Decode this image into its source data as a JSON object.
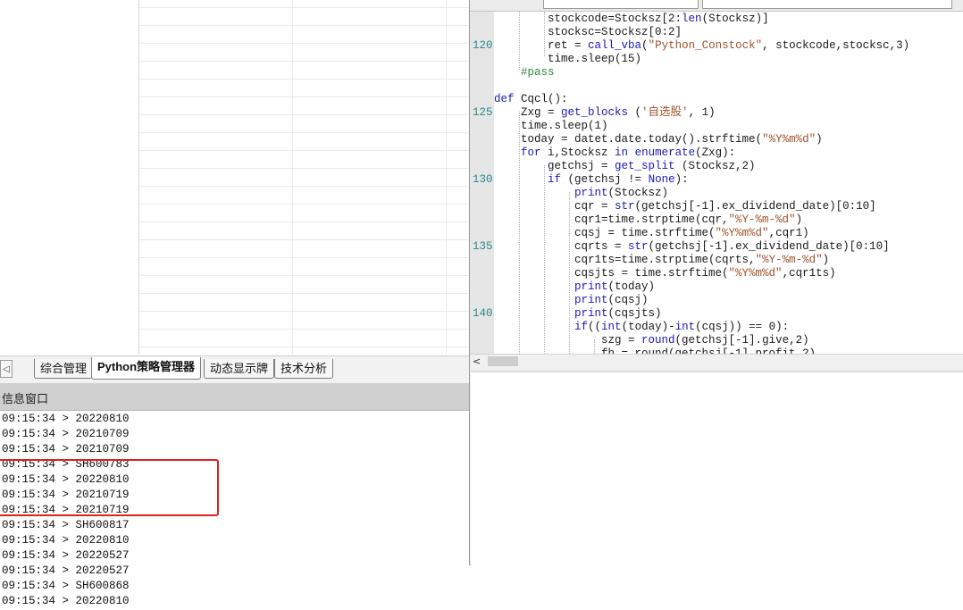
{
  "tabs": {
    "scroll_left": "◁",
    "items": [
      {
        "label": "综合管理"
      },
      {
        "label": "Python策略管理器"
      },
      {
        "label": "动态显示牌"
      },
      {
        "label": "技术分析"
      }
    ]
  },
  "info_window": {
    "title": "信息窗口",
    "lines": [
      "09:15:34 > 20220810",
      "09:15:34 > 20210709",
      "09:15:34 > 20210709",
      "09:15:34 > SH600783",
      "09:15:34 > 20220810",
      "09:15:34 > 20210719",
      "09:15:34 > 20210719",
      "09:15:34 > SH600817",
      "09:15:34 > 20220810",
      "09:15:34 > 20220527",
      "09:15:34 > 20220527",
      "09:15:34 > SH600868",
      "09:15:34 > 20220810"
    ]
  },
  "editor": {
    "line_numbers": [
      {
        "n": "120",
        "row": 2
      },
      {
        "n": "125",
        "row": 7
      },
      {
        "n": "130",
        "row": 12
      },
      {
        "n": "135",
        "row": 17
      },
      {
        "n": "140",
        "row": 22
      }
    ],
    "scroll_arrow": "<",
    "colors": {
      "keyword": "#1a1ab8",
      "string": "#a0522d",
      "comment": "#2a8a3a",
      "line_number": "#2a8a8a",
      "highlight_box": "#e02020"
    }
  }
}
